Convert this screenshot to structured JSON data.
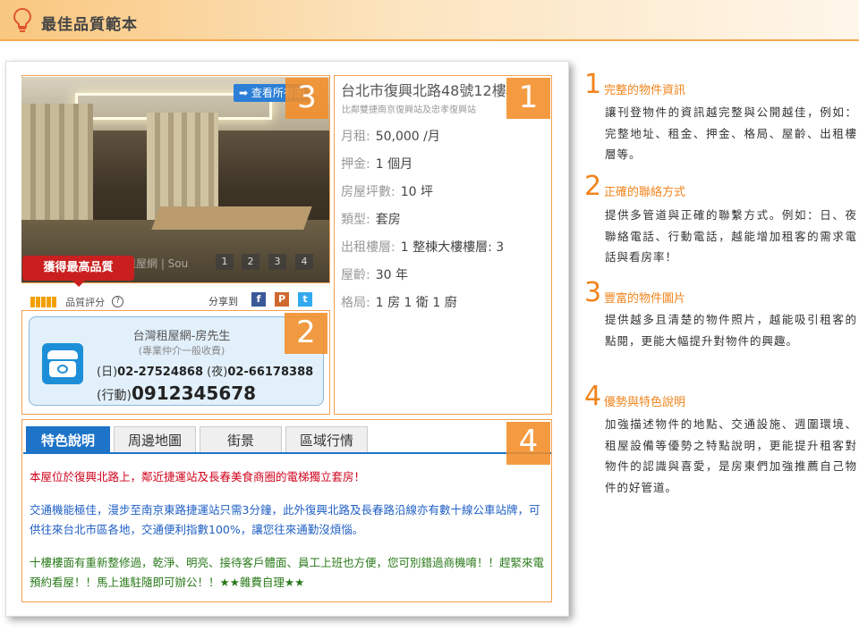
{
  "header": {
    "title": "最佳品質範本"
  },
  "photo": {
    "view_all_label": "查看所有圖",
    "watermark": "租屋網 | Sou",
    "pager": [
      "1",
      "2",
      "3",
      "4"
    ]
  },
  "award_label": "獲得最高品質",
  "rating": {
    "label": "品質評分",
    "help": "?"
  },
  "share": {
    "label": "分享到",
    "icons": [
      "f",
      "P",
      "t"
    ]
  },
  "contact": {
    "name": "台灣租屋網-房先生",
    "note": "(專業仲介一般收費)",
    "day_label": "(日)",
    "day_phone": "02-27524868",
    "night_label": "(夜)",
    "night_phone": "02-66178388",
    "mobile_label": "(行動)",
    "mobile_phone": "0912345678"
  },
  "listing": {
    "title": "台北市復興北路48號12樓",
    "subtitle": "比鄰雙捷南京復興站及忠孝復興站",
    "rows": [
      {
        "key": "月租:",
        "value": "50,000 /月"
      },
      {
        "key": "押金:",
        "value": "1 個月"
      },
      {
        "key": "房屋坪數:",
        "value": "10 坪"
      },
      {
        "key": "類型:",
        "value": "套房"
      },
      {
        "key": "出租樓層:",
        "value": "1 整棟大樓樓層: 3"
      },
      {
        "key": "屋齡:",
        "value": "30 年"
      },
      {
        "key": "格局:",
        "value": "1 房 1 衛 1 廚"
      }
    ]
  },
  "tabs": [
    "特色說明",
    "周邊地圖",
    "街景",
    "區域行情"
  ],
  "description": {
    "p1": "本屋位於復興北路上，鄰近捷運站及長春美食商圈的電梯獨立套房！",
    "p2": "交通機能極佳，漫步至南京東路捷運站只需3分鐘，此外復興北路及長春路沿線亦有數十線公車站牌，可供往來台北市區各地，交通便利指數100%，讓您往來通勤沒煩惱。",
    "p3": "十樓樓面有重新整修過，乾淨、明亮、接待客戶體面、員工上班也方便，您可別錯過商機唷！！趕緊來電預約看屋！！馬上進駐隨即可辦公！！★★雜費自理★★"
  },
  "badges": [
    "1",
    "2",
    "3",
    "4"
  ],
  "tips": [
    {
      "num": "1",
      "title": "完整的物件資訊",
      "body": "讓刊登物件的資訊越完整與公開越佳，例如：完整地址、租金、押金、格局、屋齡、出租樓層等。"
    },
    {
      "num": "2",
      "title": "正確的聯絡方式",
      "body": "提供多管道與正確的聯繫方式。例如：日、夜聯絡電話、行動電話，越能增加租客的需求電話與看房率！"
    },
    {
      "num": "3",
      "title": "豐富的物件圖片",
      "body": "提供越多且清楚的物件照片，越能吸引租客的點閱，更能大幅提升對物件的興趣。"
    },
    {
      "num": "4",
      "title": "優勢與特色說明",
      "body": "加強描述物件的地點、交通設施、週圍環境、租屋設備等優勢之特點說明，更能提升租客對物件的認識與喜愛，是房東們加強推薦自己物件的好管道。"
    }
  ],
  "colors": {
    "accent": "#f0841d",
    "tab_active": "#1e74c9",
    "award": "#c9201f",
    "desc_red": "#d0021b",
    "desc_blue": "#1f5fc4",
    "desc_green": "#2a7a1a"
  }
}
